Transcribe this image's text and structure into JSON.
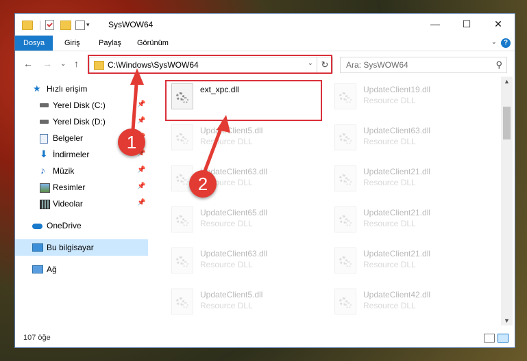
{
  "window": {
    "title": "SysWOW64",
    "controls": {
      "minimize": "—",
      "maximize": "☐",
      "close": "✕"
    }
  },
  "ribbon": {
    "tabs": [
      "Dosya",
      "Giriş",
      "Paylaş",
      "Görünüm"
    ],
    "help": "?"
  },
  "address": {
    "path": "C:\\Windows\\SysWOW64",
    "search_placeholder": "Ara: SysWOW64"
  },
  "sidebar": {
    "items": [
      {
        "label": "Hızlı erişim",
        "icon": "star-icon",
        "pinned": false
      },
      {
        "label": "Yerel Disk (C:)",
        "icon": "drive-icon",
        "pinned": true
      },
      {
        "label": "Yerel Disk (D:)",
        "icon": "drive-icon",
        "pinned": true
      },
      {
        "label": "Belgeler",
        "icon": "documents-icon",
        "pinned": true
      },
      {
        "label": "İndirmeler",
        "icon": "download-icon",
        "pinned": true
      },
      {
        "label": "Müzik",
        "icon": "music-icon",
        "pinned": true
      },
      {
        "label": "Resimler",
        "icon": "pictures-icon",
        "pinned": true
      },
      {
        "label": "Videolar",
        "icon": "videos-icon",
        "pinned": true
      },
      {
        "label": "OneDrive",
        "icon": "cloud-icon",
        "pinned": false
      },
      {
        "label": "Bu bilgisayar",
        "icon": "computer-icon",
        "pinned": false,
        "selected": true
      },
      {
        "label": "Ağ",
        "icon": "network-icon",
        "pinned": false
      }
    ]
  },
  "files": {
    "left": [
      {
        "name": "ext_xpc.dll",
        "type": ""
      },
      {
        "name": "UpdateClient5.dll",
        "type": "Resource DLL"
      },
      {
        "name": "UpdateClient63.dll",
        "type": "Resource DLL"
      },
      {
        "name": "UpdateClient65.dll",
        "type": "Resource DLL"
      },
      {
        "name": "UpdateClient63.dll",
        "type": "Resource DLL"
      },
      {
        "name": "UpdateClient5.dll",
        "type": "Resource DLL"
      }
    ],
    "right": [
      {
        "name": "UpdateClient19.dll",
        "type": "Resource DLL"
      },
      {
        "name": "UpdateClient63.dll",
        "type": "Resource DLL"
      },
      {
        "name": "UpdateClient21.dll",
        "type": "Resource DLL"
      },
      {
        "name": "UpdateClient21.dll",
        "type": "Resource DLL"
      },
      {
        "name": "UpdateClient21.dll",
        "type": "Resource DLL"
      },
      {
        "name": "UpdateClient42.dll",
        "type": "Resource DLL"
      }
    ]
  },
  "status": {
    "count": "107 öğe"
  },
  "callouts": [
    "1",
    "2"
  ],
  "colors": {
    "accent": "#1979ca",
    "highlight": "#d9303a",
    "selected": "#cce8ff"
  }
}
